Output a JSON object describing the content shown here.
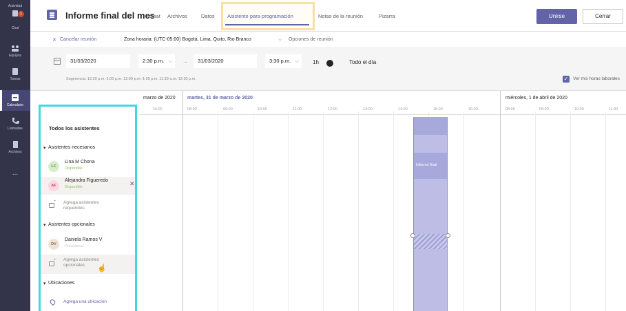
{
  "rail": {
    "items": [
      {
        "label": "Actividad",
        "icon": "bell-icon",
        "badge": "1"
      },
      {
        "label": "Chat",
        "icon": "chat-icon"
      },
      {
        "label": "Equipos",
        "icon": "teams-icon"
      },
      {
        "label": "Tareas",
        "icon": "tasks-icon"
      },
      {
        "label": "Calendario",
        "icon": "calendar-icon",
        "active": true
      },
      {
        "label": "Llamadas",
        "icon": "phone-icon"
      },
      {
        "label": "Archivos",
        "icon": "files-icon"
      },
      {
        "label": "...",
        "icon": "more-icon"
      }
    ]
  },
  "header": {
    "title": "Informe final del mes",
    "tabs": [
      "Chat",
      "Archivos",
      "Datos",
      "Asistente para programación",
      "Notas de la reunión",
      "Pizarra"
    ],
    "active_tab": "Asistente para programación",
    "join_label": "Unirse",
    "close_label": "Cerrar"
  },
  "options": {
    "cancel_label": "Cancelar reunión",
    "timezone_label": "Zona horaria: (UTC-05:00) Bogotá, Lima, Quito, Rio Branco",
    "meeting_options_label": "Opciones de reunión"
  },
  "datetime": {
    "start_date": "31/03/2020",
    "start_time": "2:30 p.m.",
    "end_date": "31/03/2020",
    "end_time": "3:30 p.m.",
    "duration": "1h",
    "all_day_label": "Todo el día",
    "suggestions": "Sugerencia: 12:30 p.m.-1:00 p.m. 12:00 p.m.-1:00 p.m. 11:30 a.m.-12:30 p.m.",
    "working_hours_label": "Ver mis horas laborales"
  },
  "calendar": {
    "prev_day_label": "marzo de 2020",
    "day_label": "martes, 31 de marzo de 2020",
    "next_day_label": "miércoles, 1 de abril de 2020",
    "prev_hours": [
      "16:00"
    ],
    "hours": [
      "08:00",
      "09:00",
      "10:00",
      "11:00",
      "12:00",
      "13:00",
      "14:00",
      "15:00",
      "16:00"
    ],
    "next_hours": [
      "08:00",
      "09:00",
      "10:00",
      "11:00"
    ],
    "meeting_label": "Informe final"
  },
  "attendees": {
    "all_label": "Todos los asistentes",
    "required_section": "Asistentes necesarios",
    "required": [
      {
        "initials": "LC",
        "name": "Lina M Chona",
        "status": "Disponible"
      },
      {
        "initials": "AF",
        "name": "Alejandra Figueredo",
        "status": "Disponible"
      }
    ],
    "add_required_label": "Agrega asistentes requeridos",
    "optional_section": "Asistentes opcionales",
    "optional": [
      {
        "initials": "DV",
        "name": "Daniela Ramos V",
        "status": "Provisional"
      }
    ],
    "add_optional_label": "Agrega asistentes opcionales",
    "locations_section": "Ubicaciones",
    "add_location_label": "Agrega una ubicación"
  },
  "colors": {
    "brand": "#6264a7",
    "rail": "#33344a",
    "highlight_tab": "#f8dfa4",
    "panel_border": "#40d7e3",
    "available": "#92c353"
  }
}
